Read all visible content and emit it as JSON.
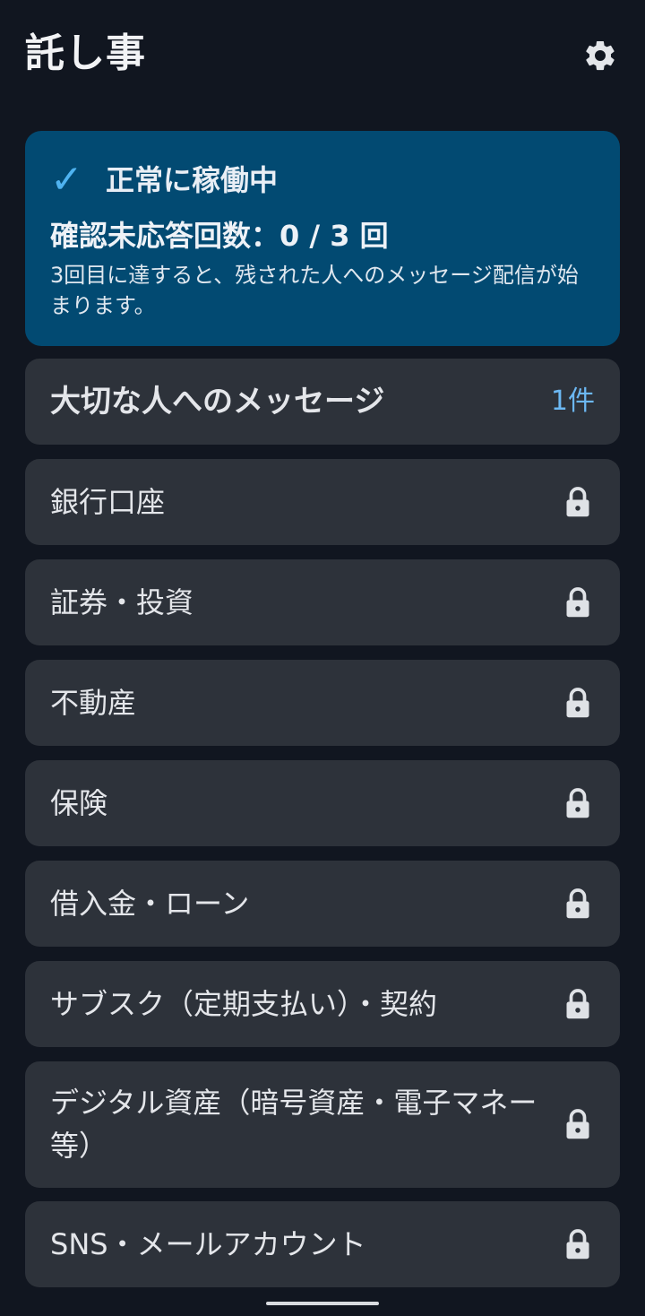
{
  "header": {
    "title": "託し事",
    "settings_icon": "gear-icon"
  },
  "status": {
    "icon": "check-icon",
    "label": "正常に稼働中",
    "count_text": "確認未応答回数：0 / 3 回",
    "note": "3回目に達すると、残された人へのメッセージ配信が始まります。",
    "colors": {
      "card_bg": "#024a72",
      "accent": "#4fb3f0"
    }
  },
  "items": [
    {
      "label": "大切な人へのメッセージ",
      "count": "1件",
      "locked": false
    },
    {
      "label": "銀行口座",
      "locked": true
    },
    {
      "label": "証券・投資",
      "locked": true
    },
    {
      "label": "不動産",
      "locked": true
    },
    {
      "label": "保険",
      "locked": true
    },
    {
      "label": "借入金・ローン",
      "locked": true
    },
    {
      "label": "サブスク（定期支払い）・契約",
      "locked": true
    },
    {
      "label": "デジタル資産（暗号資産・電子マネー等）",
      "locked": true
    },
    {
      "label": "SNS・メールアカウント",
      "locked": true
    }
  ],
  "theme": {
    "background": "#111620",
    "item_bg": "#2d323a",
    "count_color": "#6cb8f3"
  }
}
